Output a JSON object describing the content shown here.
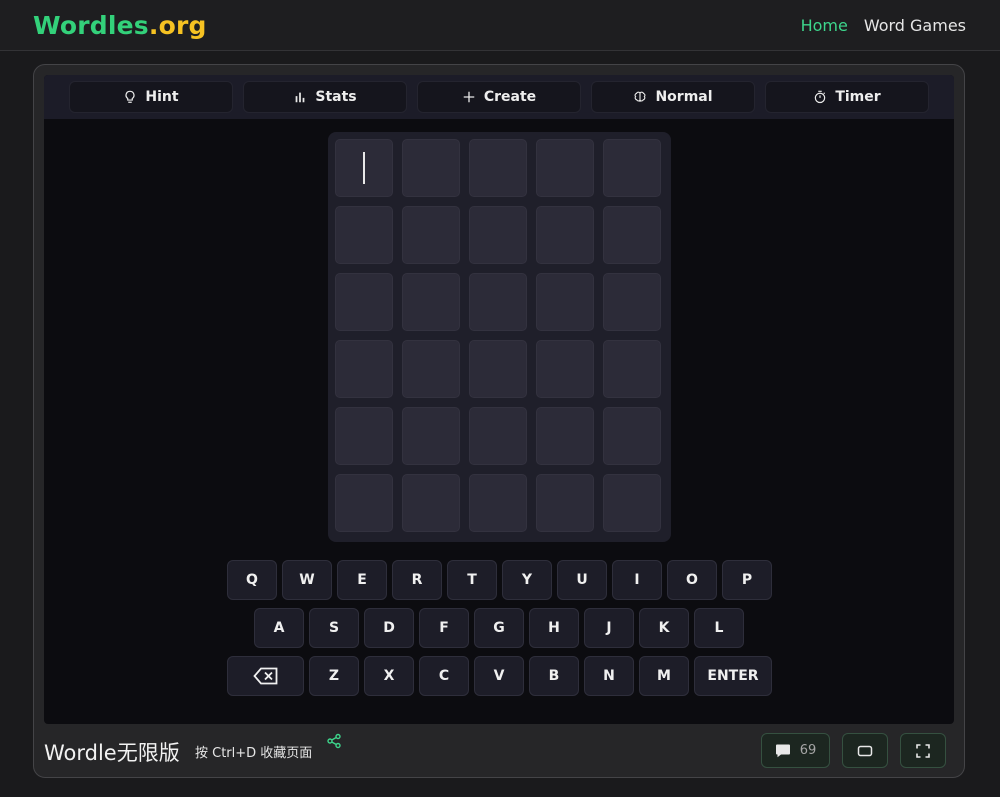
{
  "brand": {
    "part1": "Wordles",
    "part2": ".org"
  },
  "nav": {
    "home": "Home",
    "word_games": "Word Games"
  },
  "toolbar": [
    {
      "label": "Hint",
      "icon": "lightbulb-icon"
    },
    {
      "label": "Stats",
      "icon": "bar-chart-icon"
    },
    {
      "label": "Create",
      "icon": "plus-icon"
    },
    {
      "label": "Normal",
      "icon": "brain-icon"
    },
    {
      "label": "Timer",
      "icon": "stopwatch-icon"
    }
  ],
  "board": {
    "rows": 6,
    "cols": 5,
    "active_cell": [
      0,
      0
    ]
  },
  "keyboard": {
    "row1": [
      "Q",
      "W",
      "E",
      "R",
      "T",
      "Y",
      "U",
      "I",
      "O",
      "P"
    ],
    "row2": [
      "A",
      "S",
      "D",
      "F",
      "G",
      "H",
      "J",
      "K",
      "L"
    ],
    "row3": [
      "backspace",
      "Z",
      "X",
      "C",
      "V",
      "B",
      "N",
      "M",
      "ENTER"
    ]
  },
  "footer": {
    "title": "Wordle无限版",
    "hint": "按 Ctrl+D 收藏页面",
    "comment_count": "69"
  },
  "colors": {
    "brand_green": "#33d17a",
    "brand_yellow": "#f6c222",
    "nav_active": "#3dd68c",
    "tile": "#2c2b38",
    "board_bg": "#0c0c10"
  }
}
